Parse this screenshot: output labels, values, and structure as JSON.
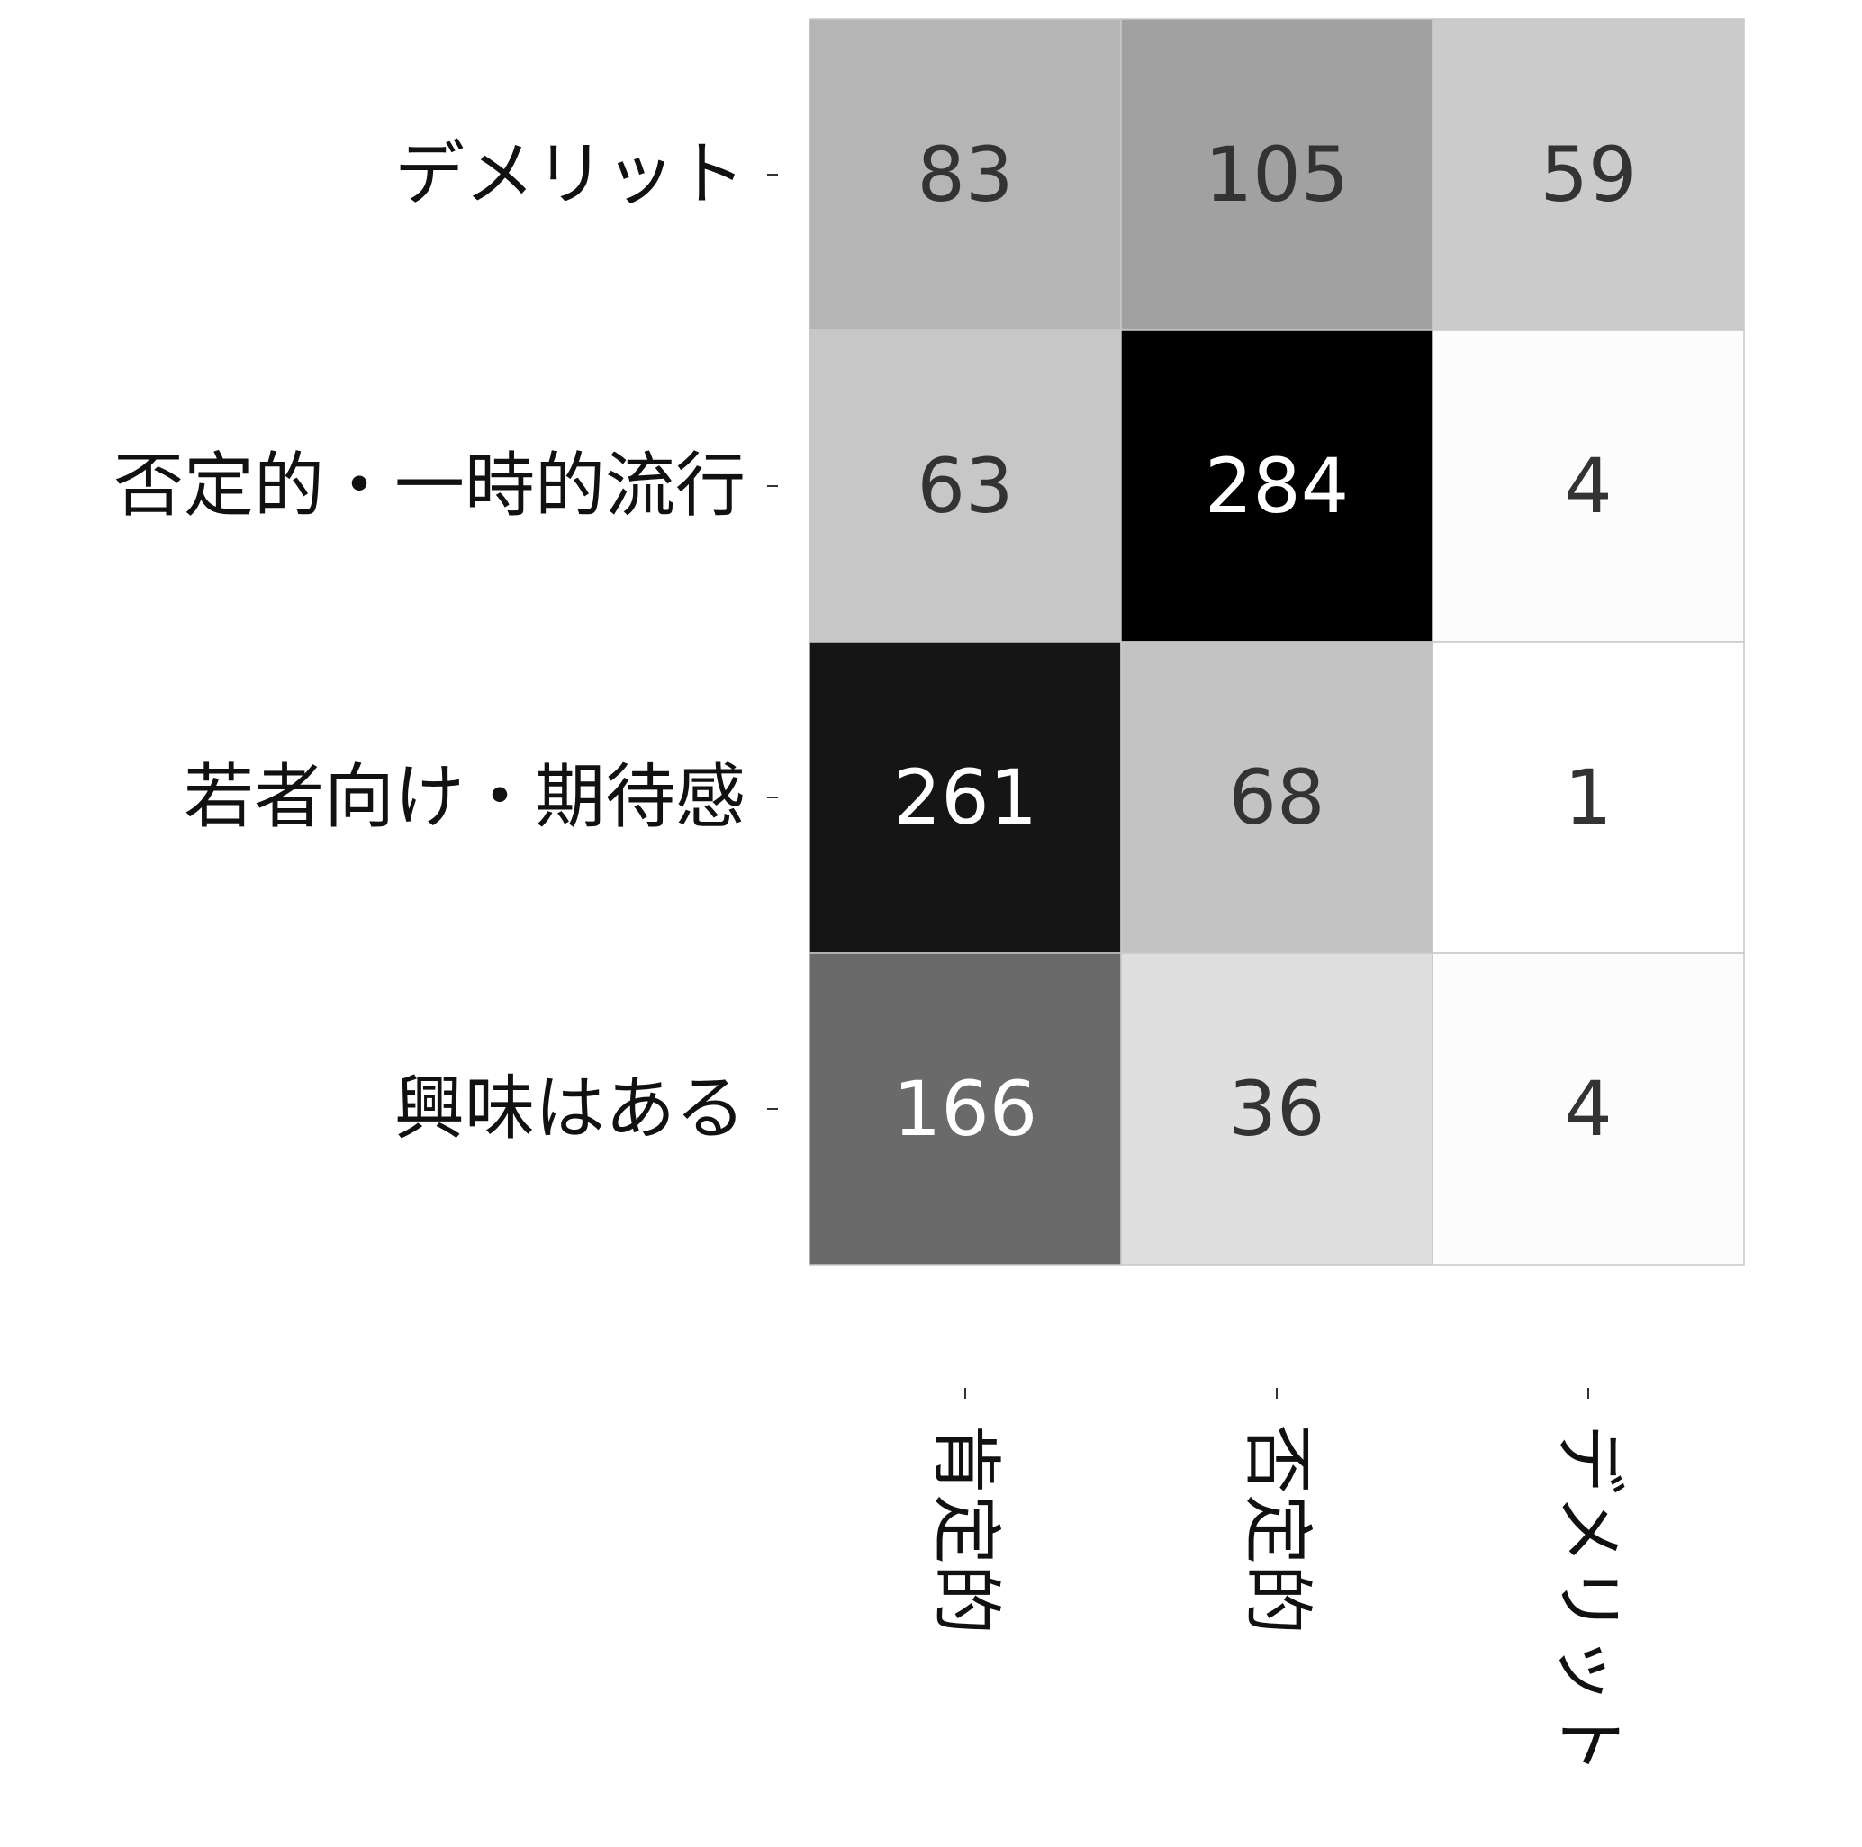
{
  "chart_data": {
    "type": "heatmap",
    "rows": [
      "デメリット",
      "否定的・一時的流行",
      "若者向け・期待感",
      "興味はある"
    ],
    "columns": [
      "肯定的",
      "否定的",
      "デメリット"
    ],
    "values": [
      [
        83,
        105,
        59
      ],
      [
        63,
        284,
        4
      ],
      [
        261,
        68,
        1
      ],
      [
        166,
        36,
        4
      ]
    ],
    "color_scale": {
      "min": 1,
      "max": 284,
      "low_color": "#ffffff",
      "high_color": "#000000"
    },
    "grid": false,
    "legend": "none"
  }
}
